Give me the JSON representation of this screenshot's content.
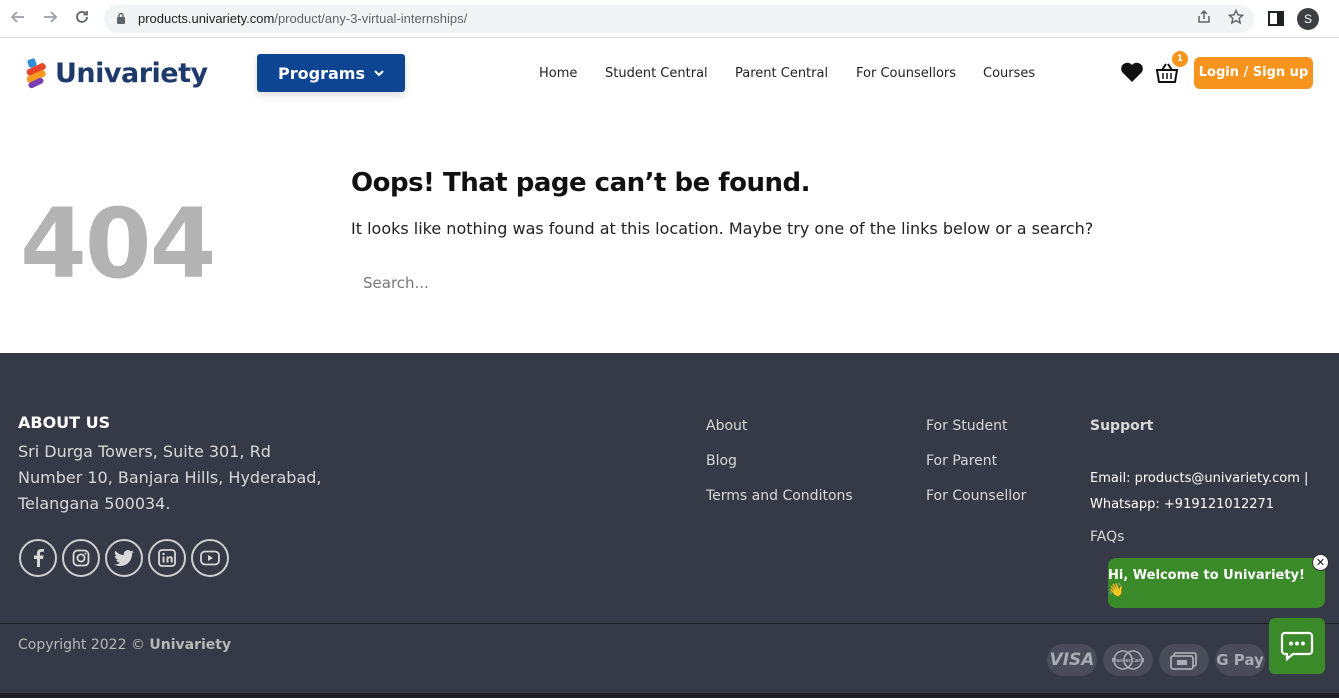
{
  "browser": {
    "url_domain": "products.univariety.com",
    "url_path": "/product/any-3-virtual-internships/",
    "profile_initial": "S"
  },
  "header": {
    "logo_text": "Univariety",
    "programs_label": "Programs",
    "nav": [
      "Home",
      "Student Central",
      "Parent Central",
      "For Counsellors",
      "Courses"
    ],
    "cart_count": "1",
    "login_label": "Login / Sign up"
  },
  "main": {
    "code": "404",
    "title": "Oops! That page can’t be found.",
    "description": "It looks like nothing was found at this location. Maybe try one of the links below or a search?",
    "search_placeholder": "Search..."
  },
  "footer": {
    "about_heading": "ABOUT US",
    "address_lines": [
      "Sri Durga Towers, Suite 301, Rd",
      "Number 10, Banjara Hills, Hyderabad,",
      "Telangana 500034."
    ],
    "social": [
      "facebook-icon",
      "instagram-icon",
      "twitter-icon",
      "linkedin-icon",
      "youtube-icon"
    ],
    "links_col1": [
      "About",
      "Blog",
      "Terms and Conditons"
    ],
    "links_col2": [
      "For Student",
      "For Parent",
      "For Counsellor"
    ],
    "support_heading": "Support",
    "contact_email": "Email: products@univariety.com |",
    "contact_whatsapp": "Whatsapp: +919121012271",
    "faqs": "FAQs",
    "copyright_prefix": "Copyright 2022 ©",
    "copyright_brand": "Univariety",
    "payments": [
      "VISA",
      "MasterCard",
      "",
      "G Pay"
    ]
  },
  "chat": {
    "welcome": "Hi, Welcome to Univariety! 👋",
    "close": "✕"
  },
  "colors": {
    "brand_blue": "#0d4592",
    "accent_orange": "#f7941d",
    "footer_bg": "#363946",
    "chat_green": "#3b8a2a"
  }
}
